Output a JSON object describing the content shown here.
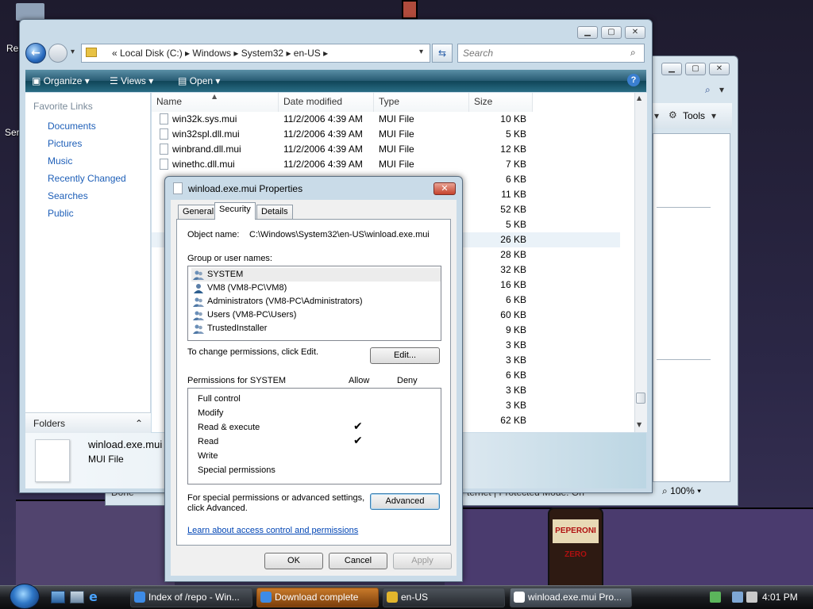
{
  "desktop": {
    "recycle_label": "Re",
    "side_label": "Ser",
    "bottle_label": "PEPERONI ZERO"
  },
  "explorer": {
    "address_crumbs": "«  Local Disk (C:)  ▸  Windows  ▸  System32  ▸  en-US  ▸",
    "search_placeholder": "Search",
    "toolbar": {
      "organize": "Organize",
      "views": "Views",
      "open": "Open"
    },
    "nav": {
      "header": "Favorite Links",
      "items": [
        {
          "label": "Documents",
          "color": "#4f81bd"
        },
        {
          "label": "Pictures",
          "color": "#6aa84f"
        },
        {
          "label": "Music",
          "color": "#4a86c5"
        },
        {
          "label": "Recently Changed",
          "color": "#7f98b5"
        },
        {
          "label": "Searches",
          "color": "#8fa7c2"
        },
        {
          "label": "Public",
          "color": "#e2b52c"
        }
      ],
      "folders_label": "Folders"
    },
    "columns": {
      "name": "Name",
      "date": "Date modified",
      "type": "Type",
      "size": "Size"
    },
    "rows": [
      {
        "name": "win32k.sys.mui",
        "date": "11/2/2006 4:39 AM",
        "type": "MUI File",
        "size": "10 KB"
      },
      {
        "name": "win32spl.dll.mui",
        "date": "11/2/2006 4:39 AM",
        "type": "MUI File",
        "size": "5 KB"
      },
      {
        "name": "winbrand.dll.mui",
        "date": "11/2/2006 4:39 AM",
        "type": "MUI File",
        "size": "12 KB"
      },
      {
        "name": "winethc.dll.mui",
        "date": "11/2/2006 4:39 AM",
        "type": "MUI File",
        "size": "7 KB"
      }
    ],
    "hidden_sizes": [
      "6 KB",
      "11 KB",
      "52 KB",
      "5 KB",
      "26 KB",
      "28 KB",
      "32 KB",
      "16 KB",
      "6 KB",
      "60 KB",
      "9 KB",
      "3 KB",
      "3 KB",
      "6 KB",
      "3 KB",
      "3 KB",
      "62 KB"
    ],
    "detail": {
      "filename": "winload.exe.mui",
      "filetype": "MUI File"
    }
  },
  "explorer2": {
    "tools": "Tools",
    "zoom": "100%",
    "status_left": "Done",
    "status_right": "ternet | Protected Mode: On"
  },
  "dialog": {
    "title": "winload.exe.mui Properties",
    "close": "✕",
    "tabs": [
      "General",
      "Security",
      "Details"
    ],
    "object_name_label": "Object name:",
    "object_name_value": "C:\\Windows\\System32\\en-US\\winload.exe.mui",
    "group_label": "Group or user names:",
    "users": [
      "SYSTEM",
      "VM8 (VM8-PC\\VM8)",
      "Administrators (VM8-PC\\Administrators)",
      "Users (VM8-PC\\Users)",
      "TrustedInstaller"
    ],
    "change_text": "To change permissions, click Edit.",
    "edit_button": "Edit...",
    "perm_label": "Permissions for SYSTEM",
    "allow": "Allow",
    "deny": "Deny",
    "permissions": [
      {
        "name": "Full control",
        "allow": ""
      },
      {
        "name": "Modify",
        "allow": ""
      },
      {
        "name": "Read & execute",
        "allow": "✔"
      },
      {
        "name": "Read",
        "allow": "✔"
      },
      {
        "name": "Write",
        "allow": ""
      },
      {
        "name": "Special permissions",
        "allow": ""
      }
    ],
    "special_text_1": "For special permissions or advanced settings,",
    "special_text_2": "click Advanced.",
    "advanced_button": "Advanced",
    "learn_link": "Learn about access control and permissions",
    "ok": "OK",
    "cancel": "Cancel",
    "apply": "Apply"
  },
  "taskbar": {
    "items": [
      "Index of /repo - Win...",
      "Download complete",
      "en-US",
      "winload.exe.mui Pro..."
    ],
    "clock": "4:01 PM"
  }
}
